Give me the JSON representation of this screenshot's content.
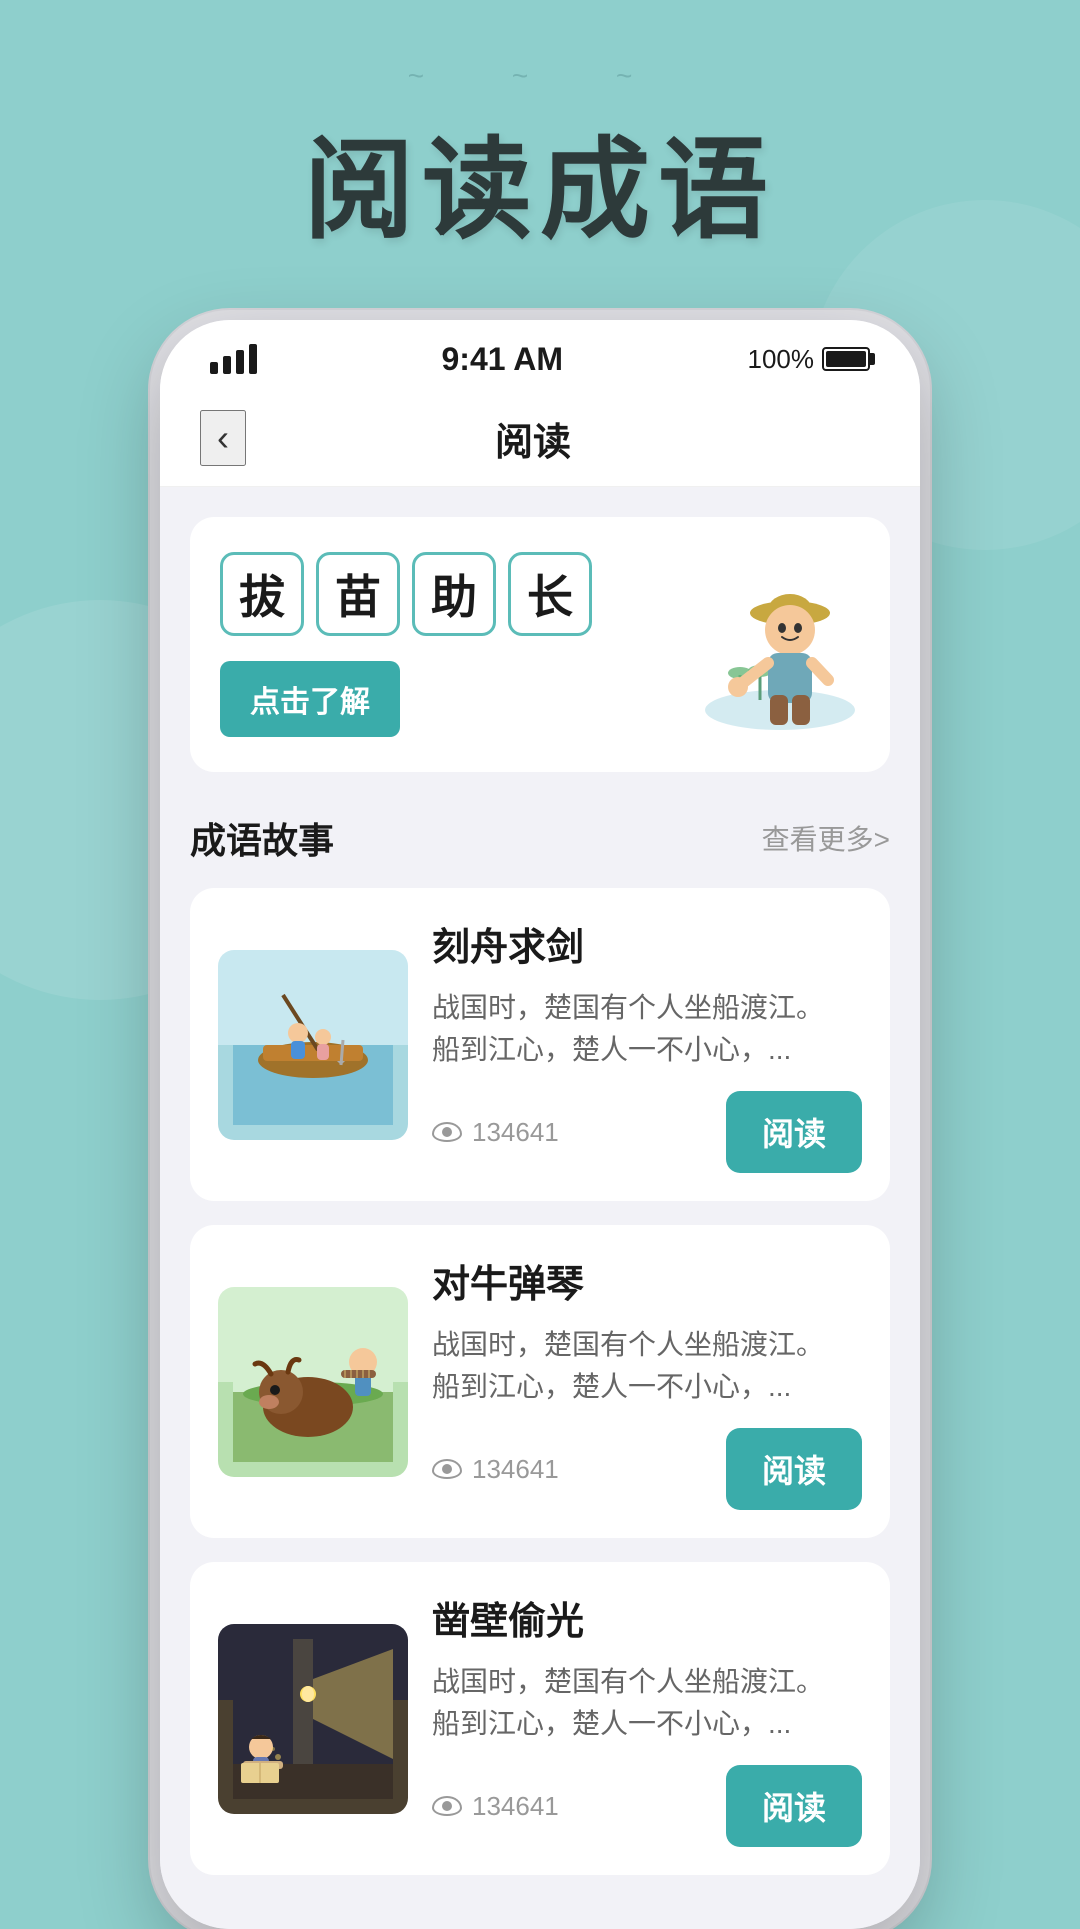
{
  "page": {
    "background_color": "#8ecfcc",
    "hero_title": "阅读成语"
  },
  "status_bar": {
    "time": "9:41 AM",
    "battery_percent": "100%"
  },
  "nav": {
    "back_label": "‹",
    "title": "阅读"
  },
  "feature_banner": {
    "characters": [
      "拔",
      "苗",
      "助",
      "长"
    ],
    "learn_button": "点击了解"
  },
  "stories_section": {
    "title": "成语故事",
    "more_label": "查看更多>",
    "items": [
      {
        "title": "刻舟求剑",
        "excerpt": "战国时，楚国有个人坐船渡江。\n船到江心，楚人一不小心，...",
        "views": "134641",
        "read_btn": "阅读",
        "thumb_style": "boat"
      },
      {
        "title": "对牛弹琴",
        "excerpt": "战国时，楚国有个人坐船渡江。\n船到江心，楚人一不小心，...",
        "views": "134641",
        "read_btn": "阅读",
        "thumb_style": "bull"
      },
      {
        "title": "凿壁偷光",
        "excerpt": "战国时，楚国有个人坐船渡江。\n船到江心，楚人一不小心，...",
        "views": "134641",
        "read_btn": "阅读",
        "thumb_style": "wall"
      }
    ]
  }
}
